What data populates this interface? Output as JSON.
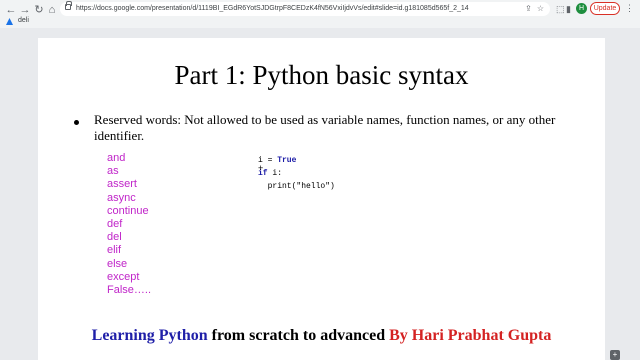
{
  "browser": {
    "url": "https://docs.google.com/presentation/d/1119BI_EGdR6YotSJDGtrpF8CEDzK4fN56VxiIjdvVs/edit#slide=id.g181085d565f_2_14",
    "bookmark_label": "deli",
    "avatar_letter": "H",
    "update_label": "Update"
  },
  "slide": {
    "title": "Part 1: Python basic syntax",
    "bullet": "Reserved words: Not allowed to be used as variable names, function names, or any other identifier.",
    "keywords": [
      "and",
      "as",
      "assert",
      "async",
      "continue",
      "def",
      "del",
      "elif",
      "else",
      "except",
      "False….."
    ],
    "code": {
      "line1_var": "i = ",
      "line1_val": "True",
      "line2_kw": "if",
      "line2_rest": " i:",
      "line3": "  print(\"hello\")"
    },
    "footer": {
      "part1": "Learning Python",
      "part2": " from scratch to advanced ",
      "part3": "By Hari Prabhat Gupta"
    }
  }
}
